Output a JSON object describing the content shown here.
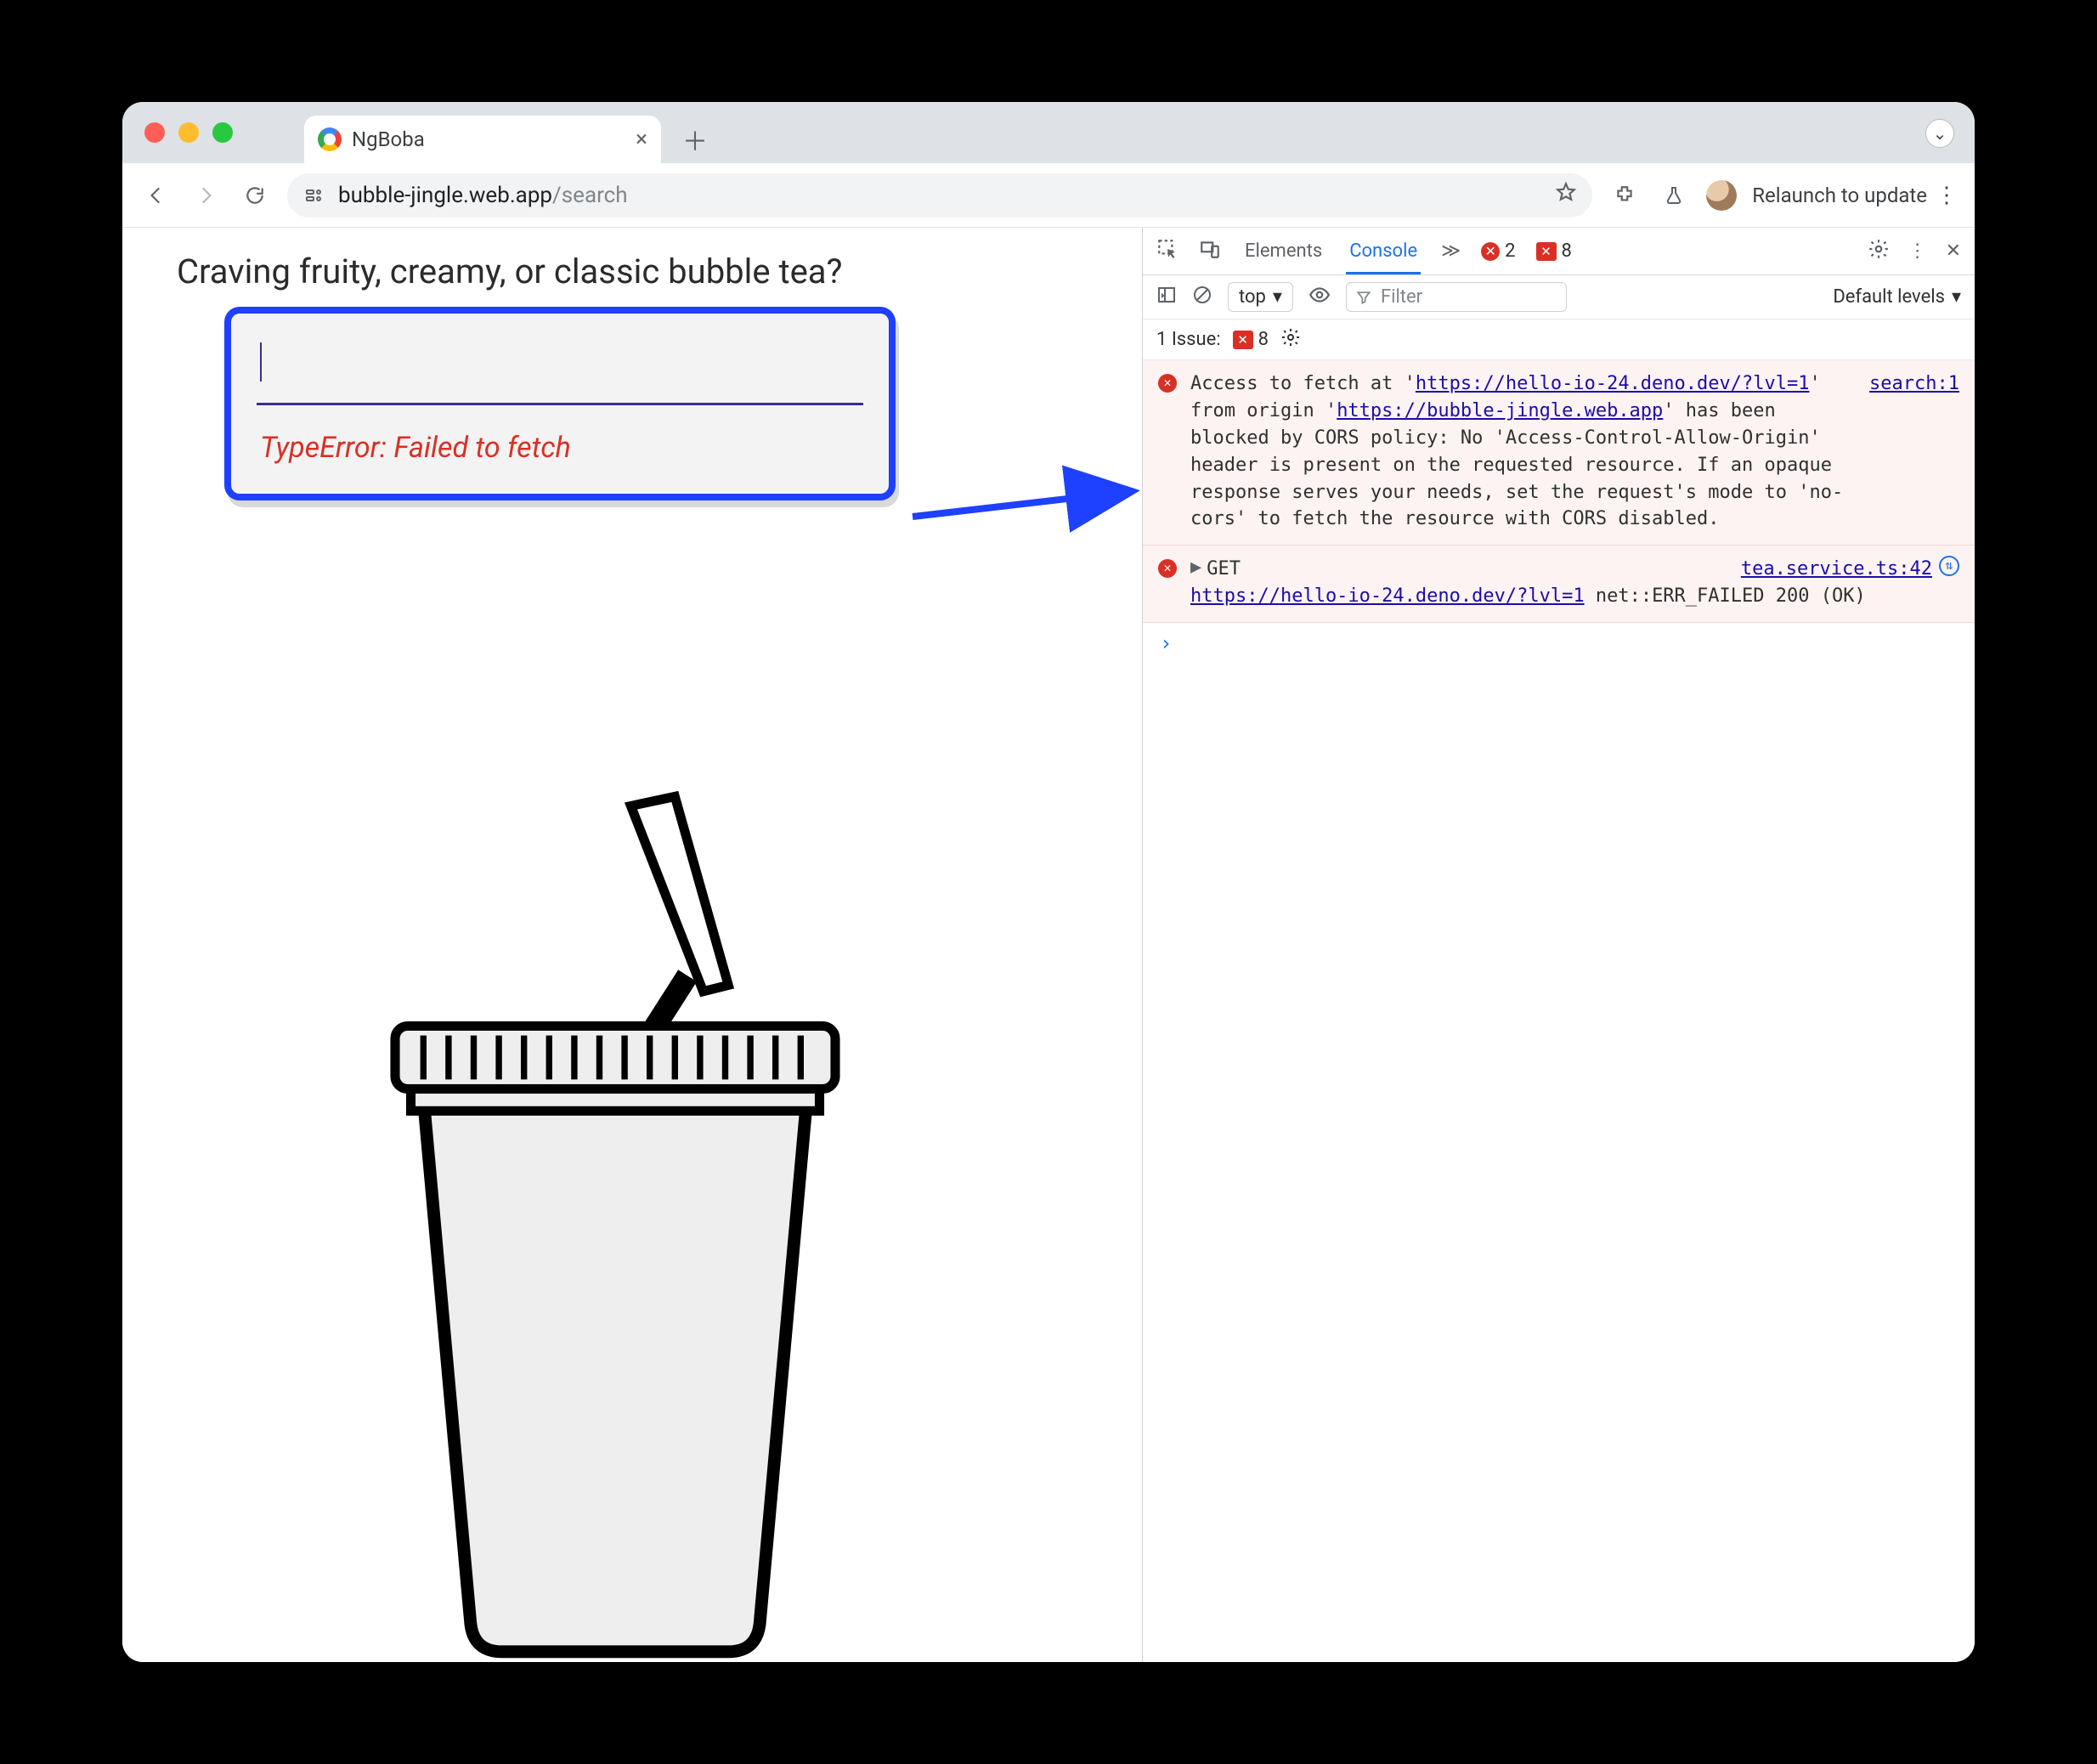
{
  "browser": {
    "tab_title": "NgBoba",
    "url_host": "bubble-jingle.web.app",
    "url_path": "/search",
    "relaunch_label": "Relaunch to update"
  },
  "page": {
    "heading": "Craving fruity, creamy, or classic bubble tea?",
    "error_text": "TypeError: Failed to fetch"
  },
  "devtools": {
    "tabs": {
      "elements": "Elements",
      "console": "Console"
    },
    "error_count": "2",
    "issue_count": "8",
    "toolbar": {
      "context": "top",
      "filter_placeholder": "Filter",
      "levels_label": "Default levels"
    },
    "issues_row": {
      "label": "1 Issue:",
      "count": "8"
    },
    "log1": {
      "pre": "Access to fetch at '",
      "url1": "https://hello-io-24.deno.dev/?lvl=1",
      "mid1": "' from origin '",
      "url2": "https://bubble-jingle.web.app",
      "post": "' has been blocked by CORS policy: No 'Access-Control-Allow-Origin' header is present on the requested resource. If an opaque response serves your needs, set the request's mode to 'no-cors' to fetch the resource with CORS disabled.",
      "source": "search:1"
    },
    "log2": {
      "method": "GET",
      "url": "https://hello-io-24.deno.dev/?lvl=1",
      "tail": " net::ERR_FAILED 200 (OK)",
      "source": "tea.service.ts:42"
    }
  }
}
